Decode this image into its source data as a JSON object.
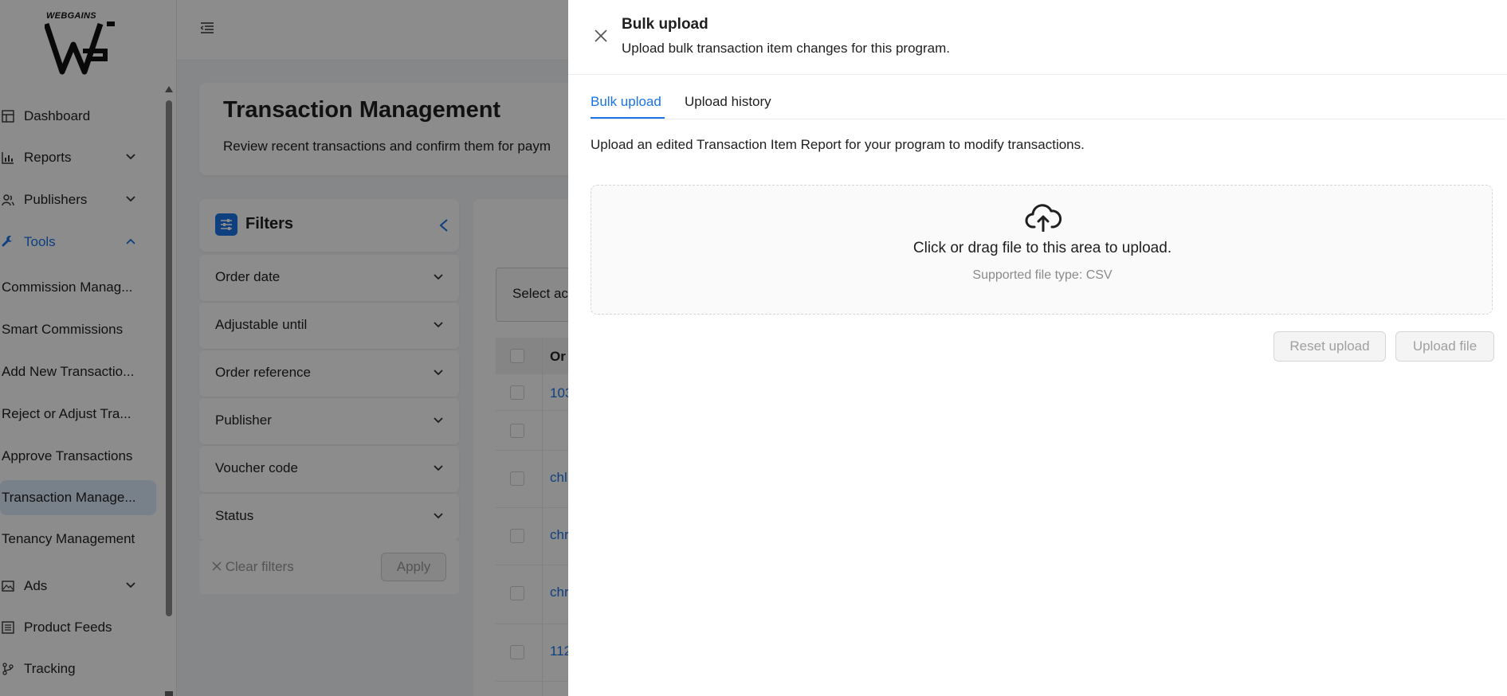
{
  "logo": {
    "text": "WEBGAINS"
  },
  "sidebar": {
    "items": [
      {
        "label": "Dashboard",
        "icon": "dashboard-icon"
      },
      {
        "label": "Reports",
        "icon": "bar-chart-icon"
      },
      {
        "label": "Publishers",
        "icon": "users-icon"
      },
      {
        "label": "Tools",
        "icon": "wrench-icon"
      }
    ],
    "tools_sub": [
      "Commission Manag...",
      "Smart Commissions",
      "Add New Transactio...",
      "Reject or Adjust Tra...",
      "Approve Transactions",
      "Transaction Manage...",
      "Tenancy Management"
    ],
    "lower_items": [
      {
        "label": "Ads",
        "icon": "image-icon"
      },
      {
        "label": "Product Feeds",
        "icon": "list-icon"
      },
      {
        "label": "Tracking",
        "icon": "branch-icon"
      }
    ]
  },
  "page": {
    "title": "Transaction Management",
    "subtitle": "Review recent transactions and confirm them for paym"
  },
  "filters": {
    "title": "Filters",
    "rows": [
      "Order date",
      "Adjustable until",
      "Order reference",
      "Publisher",
      "Voucher code",
      "Status"
    ],
    "clear_label": "Clear filters",
    "apply_label": "Apply"
  },
  "results": {
    "select_action": "Select ac",
    "order_header": "Or",
    "row_links": [
      "103",
      "",
      "chl",
      "chr",
      "chr",
      "112"
    ]
  },
  "drawer": {
    "title": "Bulk upload",
    "subtitle": "Upload bulk transaction item changes for this program.",
    "tabs": [
      "Bulk upload",
      "Upload history"
    ],
    "intro": "Upload an edited Transaction Item Report for your program to modify transactions.",
    "drop_text": "Click or drag file to this area to upload.",
    "drop_hint": "Supported file type: CSV",
    "reset_label": "Reset upload",
    "upload_label": "Upload file"
  },
  "colors": {
    "accent": "#1a73e8",
    "overlay": "rgba(0,0,0,0.45)",
    "active_nav_bg": "#dbe9fb"
  }
}
